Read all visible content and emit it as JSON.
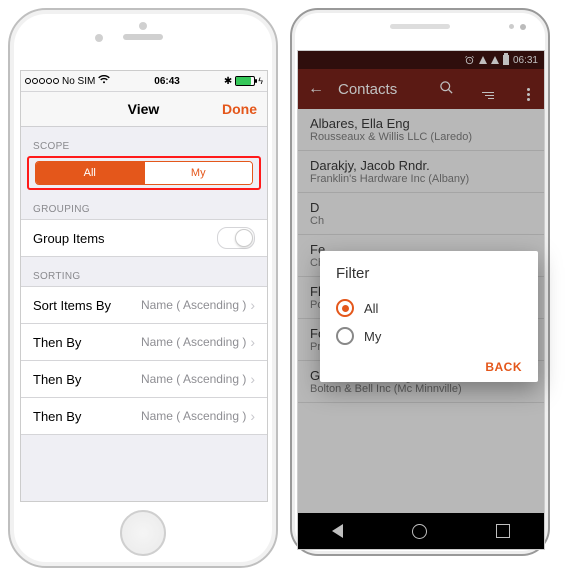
{
  "ios": {
    "status": {
      "carrier": "No SIM",
      "time": "06:43",
      "bluetooth": "✽"
    },
    "nav": {
      "title": "View",
      "done": "Done"
    },
    "scope": {
      "header": "SCOPE",
      "options": [
        "All",
        "My"
      ],
      "selected": "All"
    },
    "grouping": {
      "header": "GROUPING",
      "label": "Group Items",
      "value": false
    },
    "sorting": {
      "header": "SORTING",
      "rows": [
        {
          "label": "Sort Items By",
          "value": "Name ( Ascending )"
        },
        {
          "label": "Then By",
          "value": "Name ( Ascending )"
        },
        {
          "label": "Then By",
          "value": "Name ( Ascending )"
        },
        {
          "label": "Then By",
          "value": "Name ( Ascending )"
        }
      ]
    }
  },
  "android": {
    "status": {
      "time": "06:31"
    },
    "toolbar": {
      "title": "Contacts"
    },
    "contacts": [
      {
        "name": "Albares, Ella Eng",
        "sub": "Rousseaux & Willis LLC (Laredo)"
      },
      {
        "name": "Darakjy, Jacob Rndr.",
        "sub": "Franklin's Hardware Inc (Albany)"
      },
      {
        "name": "D",
        "sub": "Ch"
      },
      {
        "name": "Fe",
        "sub": "Ch"
      },
      {
        "name": "Fl",
        "sub": "Post Box Services Plus (Rockford)"
      },
      {
        "name": "Foller, Luke",
        "sub": "Printing Dimensions (Hamilton)"
      },
      {
        "name": "Garufi, Olivia Eng",
        "sub": "Bolton & Bell Inc (Mc Minnville)"
      }
    ],
    "dialog": {
      "title": "Filter",
      "options": [
        "All",
        "My"
      ],
      "selected": "All",
      "back": "BACK"
    }
  }
}
